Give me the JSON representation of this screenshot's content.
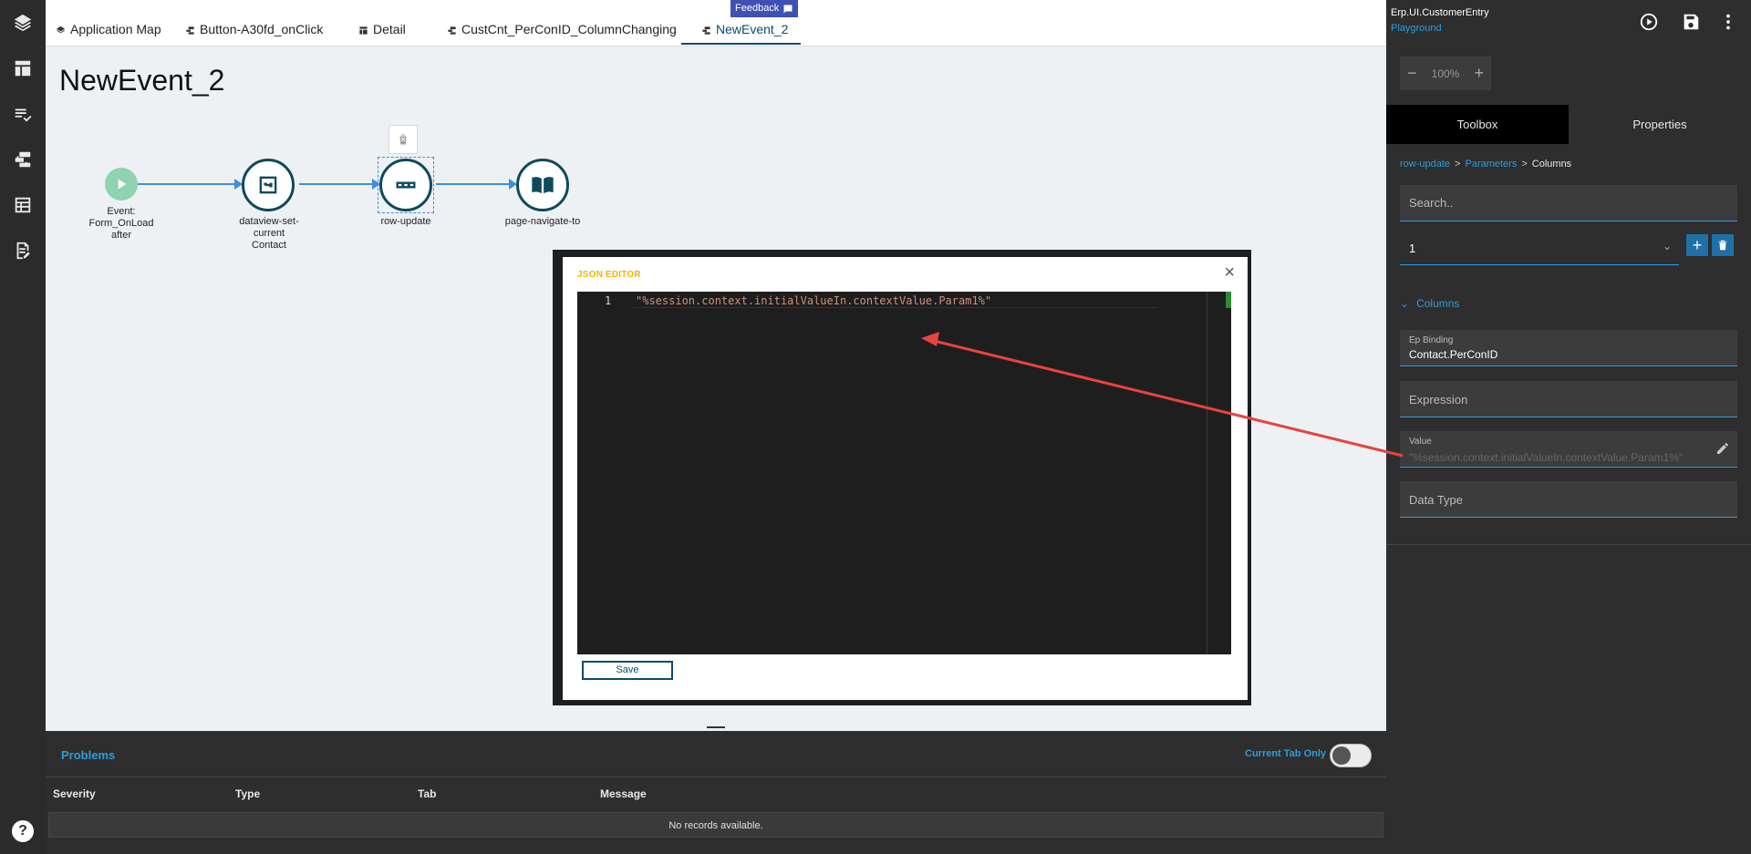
{
  "tabs": [
    {
      "label": "Application Map",
      "icon": "layers-icon"
    },
    {
      "label": "Button-A30fd_onClick",
      "icon": "flow-icon"
    },
    {
      "label": "Detail",
      "icon": "layout-icon"
    },
    {
      "label": "CustCnt_PerConID_ColumnChanging",
      "icon": "flow-icon"
    },
    {
      "label": "NewEvent_2",
      "icon": "flow-icon"
    }
  ],
  "feedback_label": "Feedback",
  "page_title": "NewEvent_2",
  "flow": {
    "nodes": [
      {
        "type": "start",
        "label_lines": [
          "Event:",
          "Form_OnLoad",
          "after"
        ]
      },
      {
        "type": "link",
        "label_lines": [
          "dataview-set-",
          "current",
          "Contact"
        ]
      },
      {
        "type": "more",
        "label_lines": [
          "row-update"
        ]
      },
      {
        "type": "book",
        "label_lines": [
          "page-navigate-to"
        ]
      }
    ]
  },
  "json_editor": {
    "title": "JSON EDITOR",
    "close": "×",
    "line_number": "1",
    "code": "\"%session.context.initialValueIn.contextValue.Param1%\"",
    "save_label": "Save"
  },
  "problems": {
    "title": "Problems",
    "toggle_label": "Current Tab Only",
    "toggle_on": false,
    "columns": [
      "Severity",
      "Type",
      "Tab",
      "Message"
    ],
    "empty_message": "No records available."
  },
  "right_panel": {
    "app_name": "Erp.UI.CustomerEntry",
    "environment": "Playground",
    "zoom": "100%",
    "zoom_minus": "−",
    "zoom_plus": "+",
    "tabs": {
      "toolbox": "Toolbox",
      "properties": "Properties"
    },
    "breadcrumb": {
      "a": "row-update",
      "b": "Parameters",
      "c": "Columns"
    },
    "search_placeholder": "Search..",
    "selected_index": "1",
    "add_symbol": "+",
    "section_title": "Columns",
    "fields": {
      "ep_binding_label": "Ep Binding",
      "ep_binding_value": "Contact.PerConID",
      "expression_label": "Expression",
      "value_label": "Value",
      "value_value": "\"%session.context.initialValueIn.contextValue.Param1%\"",
      "data_type_label": "Data Type"
    }
  },
  "help_label": "?",
  "colors": {
    "accent": "#2d9cdb",
    "dark_accent": "#0b4a6f",
    "node_stroke": "#0e4a5c",
    "flow_line": "#3d8fd8",
    "annotation_arrow": "#e8433f"
  }
}
